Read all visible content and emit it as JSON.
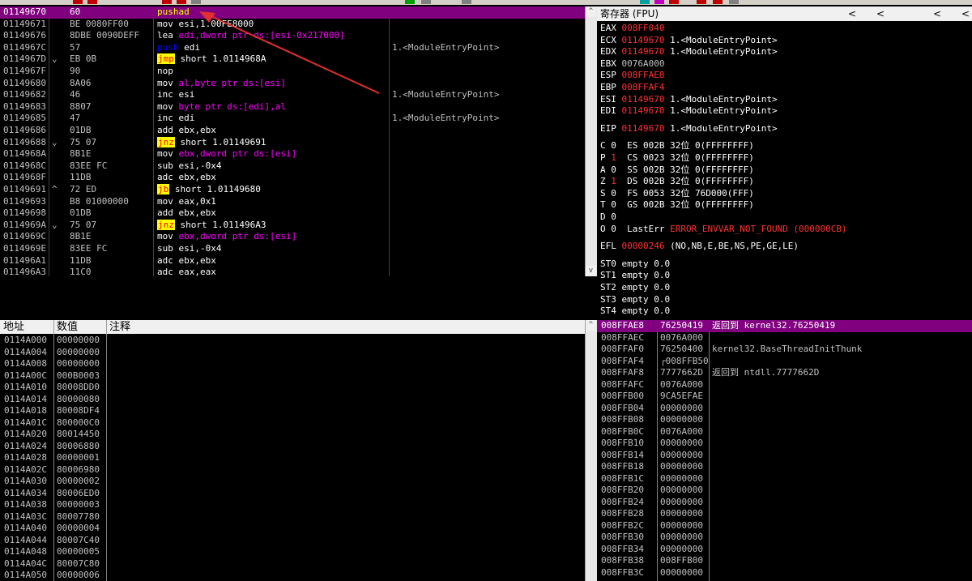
{
  "disasm": [
    {
      "addr": "01149670",
      "jmp": "",
      "hex": "60",
      "mn": "pushad",
      "mnc": "m-yellow",
      "ops": "",
      "comment": "",
      "sel": true
    },
    {
      "addr": "01149671",
      "jmp": "",
      "hex": "BE 0080FF00",
      "mn": "mov",
      "mnc": "m-white",
      "ops": "esi,1.00FE8000",
      "comment": ""
    },
    {
      "addr": "01149676",
      "jmp": "",
      "hex": "8DBE 0090DEFF",
      "mn": "lea",
      "mnc": "m-white",
      "ops": "edi,dword ptr ds:[esi-0x217000]",
      "comment": ""
    },
    {
      "addr": "0114967C",
      "jmp": "",
      "hex": "57",
      "mn": "push",
      "mnc": "m-blue",
      "ops": "edi",
      "comment": "1.<ModuleEntryPoint>"
    },
    {
      "addr": "0114967D",
      "jmp": "⌄",
      "hex": "EB 0B",
      "mn": "jmp",
      "mnc": "jbox",
      "ops": "short 1.0114968A",
      "comment": ""
    },
    {
      "addr": "0114967F",
      "jmp": "",
      "hex": "90",
      "mn": "nop",
      "mnc": "m-white",
      "ops": "",
      "comment": ""
    },
    {
      "addr": "01149680",
      "jmp": "",
      "hex": "8A06",
      "mn": "mov",
      "mnc": "m-white",
      "ops": "al,byte ptr ds:[esi]",
      "comment": ""
    },
    {
      "addr": "01149682",
      "jmp": "",
      "hex": "46",
      "mn": "inc",
      "mnc": "m-white",
      "ops": "esi",
      "comment": "1.<ModuleEntryPoint>"
    },
    {
      "addr": "01149683",
      "jmp": "",
      "hex": "8807",
      "mn": "mov",
      "mnc": "m-white",
      "ops": "byte ptr ds:[edi],al",
      "comment": ""
    },
    {
      "addr": "01149685",
      "jmp": "",
      "hex": "47",
      "mn": "inc",
      "mnc": "m-white",
      "ops": "edi",
      "comment": "1.<ModuleEntryPoint>"
    },
    {
      "addr": "01149686",
      "jmp": "",
      "hex": "01DB",
      "mn": "add",
      "mnc": "m-white",
      "ops": "ebx,ebx",
      "comment": ""
    },
    {
      "addr": "01149688",
      "jmp": "⌄",
      "hex": "75 07",
      "mn": "jnz",
      "mnc": "jbox",
      "ops": "short 1.01149691",
      "comment": ""
    },
    {
      "addr": "0114968A",
      "jmp": "",
      "hex": "8B1E",
      "mn": "mov",
      "mnc": "m-white",
      "ops": "ebx,dword ptr ds:[esi]",
      "comment": ""
    },
    {
      "addr": "0114968C",
      "jmp": "",
      "hex": "83EE FC",
      "mn": "sub",
      "mnc": "m-white",
      "ops": "esi,-0x4",
      "comment": ""
    },
    {
      "addr": "0114968F",
      "jmp": "",
      "hex": "11DB",
      "mn": "adc",
      "mnc": "m-white",
      "ops": "ebx,ebx",
      "comment": ""
    },
    {
      "addr": "01149691",
      "jmp": "^",
      "hex": "72 ED",
      "mn": "jb",
      "mnc": "jbox",
      "ops": "short 1.01149680",
      "comment": ""
    },
    {
      "addr": "01149693",
      "jmp": "",
      "hex": "B8 01000000",
      "mn": "mov",
      "mnc": "m-white",
      "ops": "eax,0x1",
      "comment": ""
    },
    {
      "addr": "01149698",
      "jmp": "",
      "hex": "01DB",
      "mn": "add",
      "mnc": "m-white",
      "ops": "ebx,ebx",
      "comment": ""
    },
    {
      "addr": "0114969A",
      "jmp": "⌄",
      "hex": "75 07",
      "mn": "jnz",
      "mnc": "jbox",
      "ops": "short 1.011496A3",
      "comment": ""
    },
    {
      "addr": "0114969C",
      "jmp": "",
      "hex": "8B1E",
      "mn": "mov",
      "mnc": "m-white",
      "ops": "ebx,dword ptr ds:[esi]",
      "comment": ""
    },
    {
      "addr": "0114969E",
      "jmp": "",
      "hex": "83EE FC",
      "mn": "sub",
      "mnc": "m-white",
      "ops": "esi,-0x4",
      "comment": ""
    },
    {
      "addr": "011496A1",
      "jmp": "",
      "hex": "11DB",
      "mn": "adc",
      "mnc": "m-white",
      "ops": "ebx,ebx",
      "comment": ""
    },
    {
      "addr": "011496A3",
      "jmp": "",
      "hex": "11C0",
      "mn": "adc",
      "mnc": "m-white",
      "ops": "eax,eax",
      "comment": ""
    }
  ],
  "registers": {
    "title": "寄存器 (FPU)",
    "nav": [
      "<",
      "<",
      "<",
      "<",
      "<"
    ],
    "gp": [
      {
        "name": "EAX",
        "val": "008FF040",
        "desc": "",
        "red": true
      },
      {
        "name": "ECX",
        "val": "01149670",
        "desc": "1.<ModuleEntryPoint>",
        "red": true
      },
      {
        "name": "EDX",
        "val": "01149670",
        "desc": "1.<ModuleEntryPoint>",
        "red": true
      },
      {
        "name": "EBX",
        "val": "0076A000",
        "desc": "",
        "red": false
      },
      {
        "name": "ESP",
        "val": "008FFAE8",
        "desc": "",
        "red": true
      },
      {
        "name": "EBP",
        "val": "008FFAF4",
        "desc": "",
        "red": true
      },
      {
        "name": "ESI",
        "val": "01149670",
        "desc": "1.<ModuleEntryPoint>",
        "red": true
      },
      {
        "name": "EDI",
        "val": "01149670",
        "desc": "1.<ModuleEntryPoint>",
        "red": true
      }
    ],
    "eip": {
      "name": "EIP",
      "val": "01149670",
      "desc": "1.<ModuleEntryPoint>"
    },
    "flags": [
      {
        "f": "C",
        "v": "0",
        "seg": "ES",
        "sv": "002B",
        "bits": "32位",
        "rng": "0(FFFFFFFF)",
        "red": false
      },
      {
        "f": "P",
        "v": "1",
        "seg": "CS",
        "sv": "0023",
        "bits": "32位",
        "rng": "0(FFFFFFFF)",
        "red": true
      },
      {
        "f": "A",
        "v": "0",
        "seg": "SS",
        "sv": "002B",
        "bits": "32位",
        "rng": "0(FFFFFFFF)",
        "red": false
      },
      {
        "f": "Z",
        "v": "1",
        "seg": "DS",
        "sv": "002B",
        "bits": "32位",
        "rng": "0(FFFFFFFF)",
        "red": true
      },
      {
        "f": "S",
        "v": "0",
        "seg": "FS",
        "sv": "0053",
        "bits": "32位",
        "rng": "76D000(FFF)",
        "red": false
      },
      {
        "f": "T",
        "v": "0",
        "seg": "GS",
        "sv": "002B",
        "bits": "32位",
        "rng": "0(FFFFFFFF)",
        "red": false
      },
      {
        "f": "D",
        "v": "0",
        "seg": "",
        "sv": "",
        "bits": "",
        "rng": "",
        "red": false
      }
    ],
    "lasterr": {
      "f": "O",
      "v": "0",
      "label": "LastErr",
      "val": "ERROR_ENVVAR_NOT_FOUND (000000CB)"
    },
    "efl": {
      "label": "EFL",
      "val": "00000246",
      "desc": "(NO,NB,E,BE,NS,PE,GE,LE)"
    },
    "fpu": [
      "ST0 empty 0.0",
      "ST1 empty 0.0",
      "ST2 empty 0.0",
      "ST3 empty 0.0",
      "ST4 empty 0.0"
    ]
  },
  "dump": {
    "headers": [
      "地址",
      "数值",
      "注释"
    ],
    "rows": [
      [
        "0114A000",
        "00000000"
      ],
      [
        "0114A004",
        "00000000"
      ],
      [
        "0114A008",
        "00000000"
      ],
      [
        "0114A00C",
        "000B0003"
      ],
      [
        "0114A010",
        "80008DD0"
      ],
      [
        "0114A014",
        "80000080"
      ],
      [
        "0114A018",
        "80008DF4"
      ],
      [
        "0114A01C",
        "800000C0"
      ],
      [
        "0114A020",
        "80014450"
      ],
      [
        "0114A024",
        "80006880"
      ],
      [
        "0114A028",
        "00000001"
      ],
      [
        "0114A02C",
        "80006980"
      ],
      [
        "0114A030",
        "00000002"
      ],
      [
        "0114A034",
        "80006ED0"
      ],
      [
        "0114A038",
        "00000003"
      ],
      [
        "0114A03C",
        "80007780"
      ],
      [
        "0114A040",
        "00000004"
      ],
      [
        "0114A044",
        "80007C40"
      ],
      [
        "0114A048",
        "00000005"
      ],
      [
        "0114A04C",
        "80007C80"
      ],
      [
        "0114A050",
        "00000006"
      ]
    ]
  },
  "stack": [
    {
      "a": "008FFAE8",
      "v": "76250419",
      "c": "返回到 kernel32.76250419",
      "sel": true
    },
    {
      "a": "008FFAEC",
      "v": "0076A000",
      "c": ""
    },
    {
      "a": "008FFAF0",
      "v": "76250400",
      "c": "kernel32.BaseThreadInitThunk"
    },
    {
      "a": "008FFAF4",
      "v": "┌008FFB50",
      "c": ""
    },
    {
      "a": "008FFAF8",
      "v": "7777662D",
      "c": "返回到 ntdll.7777662D"
    },
    {
      "a": "008FFAFC",
      "v": "0076A000",
      "c": ""
    },
    {
      "a": "008FFB00",
      "v": "9CA5EFAE",
      "c": ""
    },
    {
      "a": "008FFB04",
      "v": "00000000",
      "c": ""
    },
    {
      "a": "008FFB08",
      "v": "00000000",
      "c": ""
    },
    {
      "a": "008FFB0C",
      "v": "0076A000",
      "c": ""
    },
    {
      "a": "008FFB10",
      "v": "00000000",
      "c": ""
    },
    {
      "a": "008FFB14",
      "v": "00000000",
      "c": ""
    },
    {
      "a": "008FFB18",
      "v": "00000000",
      "c": ""
    },
    {
      "a": "008FFB1C",
      "v": "00000000",
      "c": ""
    },
    {
      "a": "008FFB20",
      "v": "00000000",
      "c": ""
    },
    {
      "a": "008FFB24",
      "v": "00000000",
      "c": ""
    },
    {
      "a": "008FFB28",
      "v": "00000000",
      "c": ""
    },
    {
      "a": "008FFB2C",
      "v": "00000000",
      "c": ""
    },
    {
      "a": "008FFB30",
      "v": "00000000",
      "c": ""
    },
    {
      "a": "008FFB34",
      "v": "00000000",
      "c": ""
    },
    {
      "a": "008FFB38",
      "v": "008FFB00",
      "c": ""
    },
    {
      "a": "008FFB3C",
      "v": "00000000",
      "c": ""
    }
  ],
  "scroll": {
    "up": "^",
    "down": "v"
  }
}
